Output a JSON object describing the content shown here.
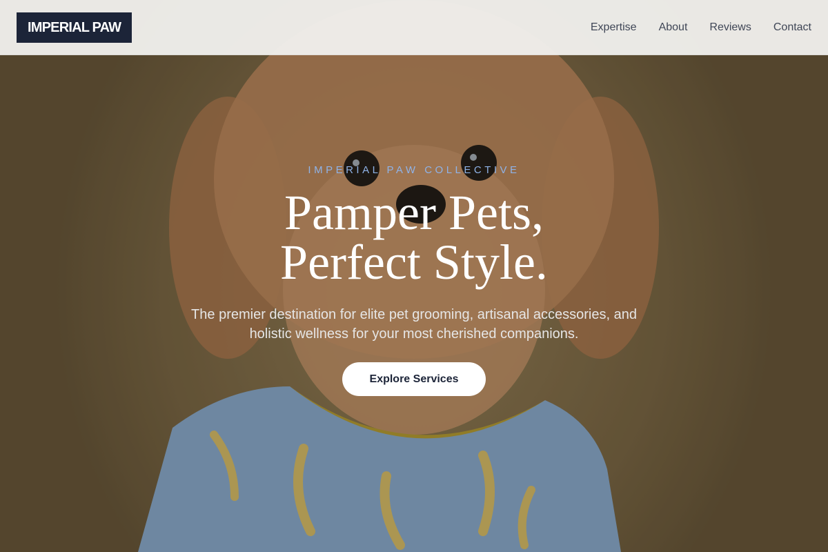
{
  "header": {
    "logo": "IMPERIAL PAW",
    "nav": [
      "Expertise",
      "About",
      "Reviews",
      "Contact"
    ]
  },
  "hero": {
    "eyebrow": "IMPERIAL PAW COLLECTIVE",
    "headline_line1": "Pamper Pets,",
    "headline_line2": "Perfect Style.",
    "subtext": "The premier destination for elite pet grooming, artisanal accessories, and holistic wellness for your most cherished companions.",
    "cta_label": "Explore Services"
  },
  "colors": {
    "logo_bg": "#1c2438",
    "eyebrow": "#8fb3e8",
    "headline": "#ffffff",
    "cta_bg": "#ffffff",
    "cta_text": "#1c2438"
  }
}
